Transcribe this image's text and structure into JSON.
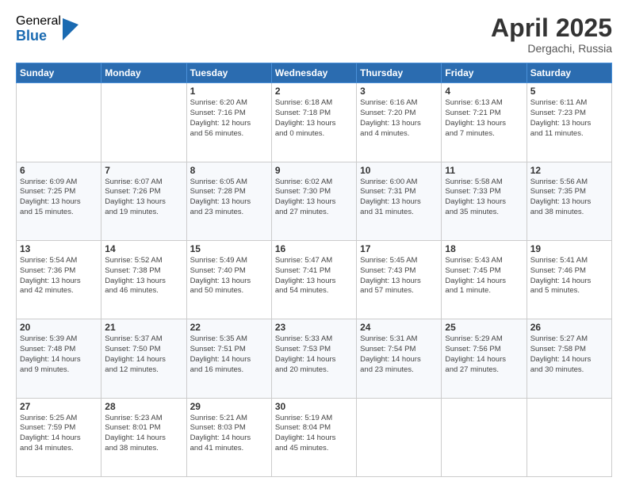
{
  "logo": {
    "general": "General",
    "blue": "Blue"
  },
  "title": "April 2025",
  "location": "Dergachi, Russia",
  "days_header": [
    "Sunday",
    "Monday",
    "Tuesday",
    "Wednesday",
    "Thursday",
    "Friday",
    "Saturday"
  ],
  "weeks": [
    [
      {
        "num": "",
        "info": ""
      },
      {
        "num": "",
        "info": ""
      },
      {
        "num": "1",
        "info": "Sunrise: 6:20 AM\nSunset: 7:16 PM\nDaylight: 12 hours\nand 56 minutes."
      },
      {
        "num": "2",
        "info": "Sunrise: 6:18 AM\nSunset: 7:18 PM\nDaylight: 13 hours\nand 0 minutes."
      },
      {
        "num": "3",
        "info": "Sunrise: 6:16 AM\nSunset: 7:20 PM\nDaylight: 13 hours\nand 4 minutes."
      },
      {
        "num": "4",
        "info": "Sunrise: 6:13 AM\nSunset: 7:21 PM\nDaylight: 13 hours\nand 7 minutes."
      },
      {
        "num": "5",
        "info": "Sunrise: 6:11 AM\nSunset: 7:23 PM\nDaylight: 13 hours\nand 11 minutes."
      }
    ],
    [
      {
        "num": "6",
        "info": "Sunrise: 6:09 AM\nSunset: 7:25 PM\nDaylight: 13 hours\nand 15 minutes."
      },
      {
        "num": "7",
        "info": "Sunrise: 6:07 AM\nSunset: 7:26 PM\nDaylight: 13 hours\nand 19 minutes."
      },
      {
        "num": "8",
        "info": "Sunrise: 6:05 AM\nSunset: 7:28 PM\nDaylight: 13 hours\nand 23 minutes."
      },
      {
        "num": "9",
        "info": "Sunrise: 6:02 AM\nSunset: 7:30 PM\nDaylight: 13 hours\nand 27 minutes."
      },
      {
        "num": "10",
        "info": "Sunrise: 6:00 AM\nSunset: 7:31 PM\nDaylight: 13 hours\nand 31 minutes."
      },
      {
        "num": "11",
        "info": "Sunrise: 5:58 AM\nSunset: 7:33 PM\nDaylight: 13 hours\nand 35 minutes."
      },
      {
        "num": "12",
        "info": "Sunrise: 5:56 AM\nSunset: 7:35 PM\nDaylight: 13 hours\nand 38 minutes."
      }
    ],
    [
      {
        "num": "13",
        "info": "Sunrise: 5:54 AM\nSunset: 7:36 PM\nDaylight: 13 hours\nand 42 minutes."
      },
      {
        "num": "14",
        "info": "Sunrise: 5:52 AM\nSunset: 7:38 PM\nDaylight: 13 hours\nand 46 minutes."
      },
      {
        "num": "15",
        "info": "Sunrise: 5:49 AM\nSunset: 7:40 PM\nDaylight: 13 hours\nand 50 minutes."
      },
      {
        "num": "16",
        "info": "Sunrise: 5:47 AM\nSunset: 7:41 PM\nDaylight: 13 hours\nand 54 minutes."
      },
      {
        "num": "17",
        "info": "Sunrise: 5:45 AM\nSunset: 7:43 PM\nDaylight: 13 hours\nand 57 minutes."
      },
      {
        "num": "18",
        "info": "Sunrise: 5:43 AM\nSunset: 7:45 PM\nDaylight: 14 hours\nand 1 minute."
      },
      {
        "num": "19",
        "info": "Sunrise: 5:41 AM\nSunset: 7:46 PM\nDaylight: 14 hours\nand 5 minutes."
      }
    ],
    [
      {
        "num": "20",
        "info": "Sunrise: 5:39 AM\nSunset: 7:48 PM\nDaylight: 14 hours\nand 9 minutes."
      },
      {
        "num": "21",
        "info": "Sunrise: 5:37 AM\nSunset: 7:50 PM\nDaylight: 14 hours\nand 12 minutes."
      },
      {
        "num": "22",
        "info": "Sunrise: 5:35 AM\nSunset: 7:51 PM\nDaylight: 14 hours\nand 16 minutes."
      },
      {
        "num": "23",
        "info": "Sunrise: 5:33 AM\nSunset: 7:53 PM\nDaylight: 14 hours\nand 20 minutes."
      },
      {
        "num": "24",
        "info": "Sunrise: 5:31 AM\nSunset: 7:54 PM\nDaylight: 14 hours\nand 23 minutes."
      },
      {
        "num": "25",
        "info": "Sunrise: 5:29 AM\nSunset: 7:56 PM\nDaylight: 14 hours\nand 27 minutes."
      },
      {
        "num": "26",
        "info": "Sunrise: 5:27 AM\nSunset: 7:58 PM\nDaylight: 14 hours\nand 30 minutes."
      }
    ],
    [
      {
        "num": "27",
        "info": "Sunrise: 5:25 AM\nSunset: 7:59 PM\nDaylight: 14 hours\nand 34 minutes."
      },
      {
        "num": "28",
        "info": "Sunrise: 5:23 AM\nSunset: 8:01 PM\nDaylight: 14 hours\nand 38 minutes."
      },
      {
        "num": "29",
        "info": "Sunrise: 5:21 AM\nSunset: 8:03 PM\nDaylight: 14 hours\nand 41 minutes."
      },
      {
        "num": "30",
        "info": "Sunrise: 5:19 AM\nSunset: 8:04 PM\nDaylight: 14 hours\nand 45 minutes."
      },
      {
        "num": "",
        "info": ""
      },
      {
        "num": "",
        "info": ""
      },
      {
        "num": "",
        "info": ""
      }
    ]
  ]
}
